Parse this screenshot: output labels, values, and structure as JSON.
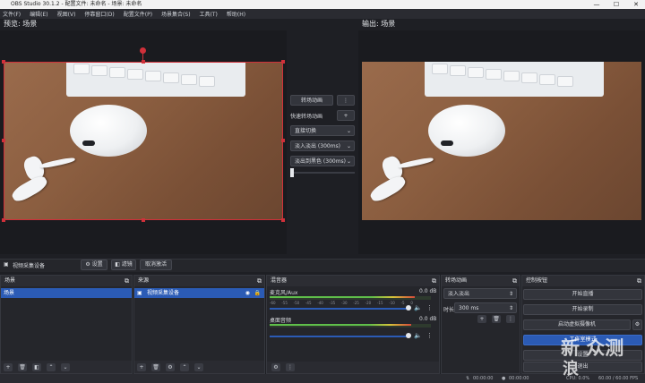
{
  "window": {
    "title": "OBS Studio 30.1.2 - 配置文件: 未命名 - 场景: 未命名",
    "min": "—",
    "max": "☐",
    "close": "✕"
  },
  "menu": [
    "文件(F)",
    "编辑(E)",
    "视图(V)",
    "停靠窗口(D)",
    "配置文件(P)",
    "场景集合(S)",
    "工具(T)",
    "帮助(H)"
  ],
  "preview": {
    "label": "预览: 场景"
  },
  "output": {
    "label": "输出: 场景"
  },
  "transition_panel": {
    "transition_button": "转场动画",
    "more": "⋮",
    "quick_label": "快速转场动画",
    "add": "+",
    "options": [
      "直接切换",
      "淡入淡出 (300ms)",
      "淡出到黑色 (300ms)"
    ]
  },
  "source_toolbar": {
    "source_name": "视频采集设备",
    "settings": "设置",
    "filters": "滤镜",
    "deactivate": "取消激活"
  },
  "docks": {
    "scenes": {
      "title": "场景",
      "items": [
        "场景"
      ]
    },
    "sources": {
      "title": "来源",
      "items": [
        "视频采集设备"
      ]
    },
    "mixer": {
      "title": "混音器",
      "channels": [
        {
          "name": "麦克风/Aux",
          "db": "0.0 dB",
          "level": 0.9
        },
        {
          "name": "桌面音频",
          "db": "0.0 dB",
          "level": 0.88
        }
      ],
      "ticks": [
        "-60",
        "-55",
        "-50",
        "-45",
        "-40",
        "-35",
        "-30",
        "-25",
        "-20",
        "-15",
        "-10",
        "-5",
        "0"
      ]
    },
    "transitions": {
      "title": "转场动画",
      "selected": "淡入淡出",
      "duration_label": "时长",
      "duration_value": "300 ms"
    },
    "controls": {
      "title": "控制按钮",
      "buttons": [
        "开始直播",
        "开始录制",
        "启动虚拟摄像机",
        "工作室模式",
        "设置",
        "退出"
      ]
    }
  },
  "statusbar": {
    "time1": "00:00:00",
    "time2": "00:00:00",
    "cpu": "CPU: 0.0%",
    "fps": "60.00 / 60.00 FPS"
  },
  "watermark": {
    "line1": "新 众测",
    "line2": "浪"
  },
  "colors": {
    "accent": "#2b5bb5",
    "selection": "#d0303a",
    "meter_green": "#5fbf4a",
    "meter_yellow": "#d6c43a",
    "meter_red": "#d64a3a"
  }
}
